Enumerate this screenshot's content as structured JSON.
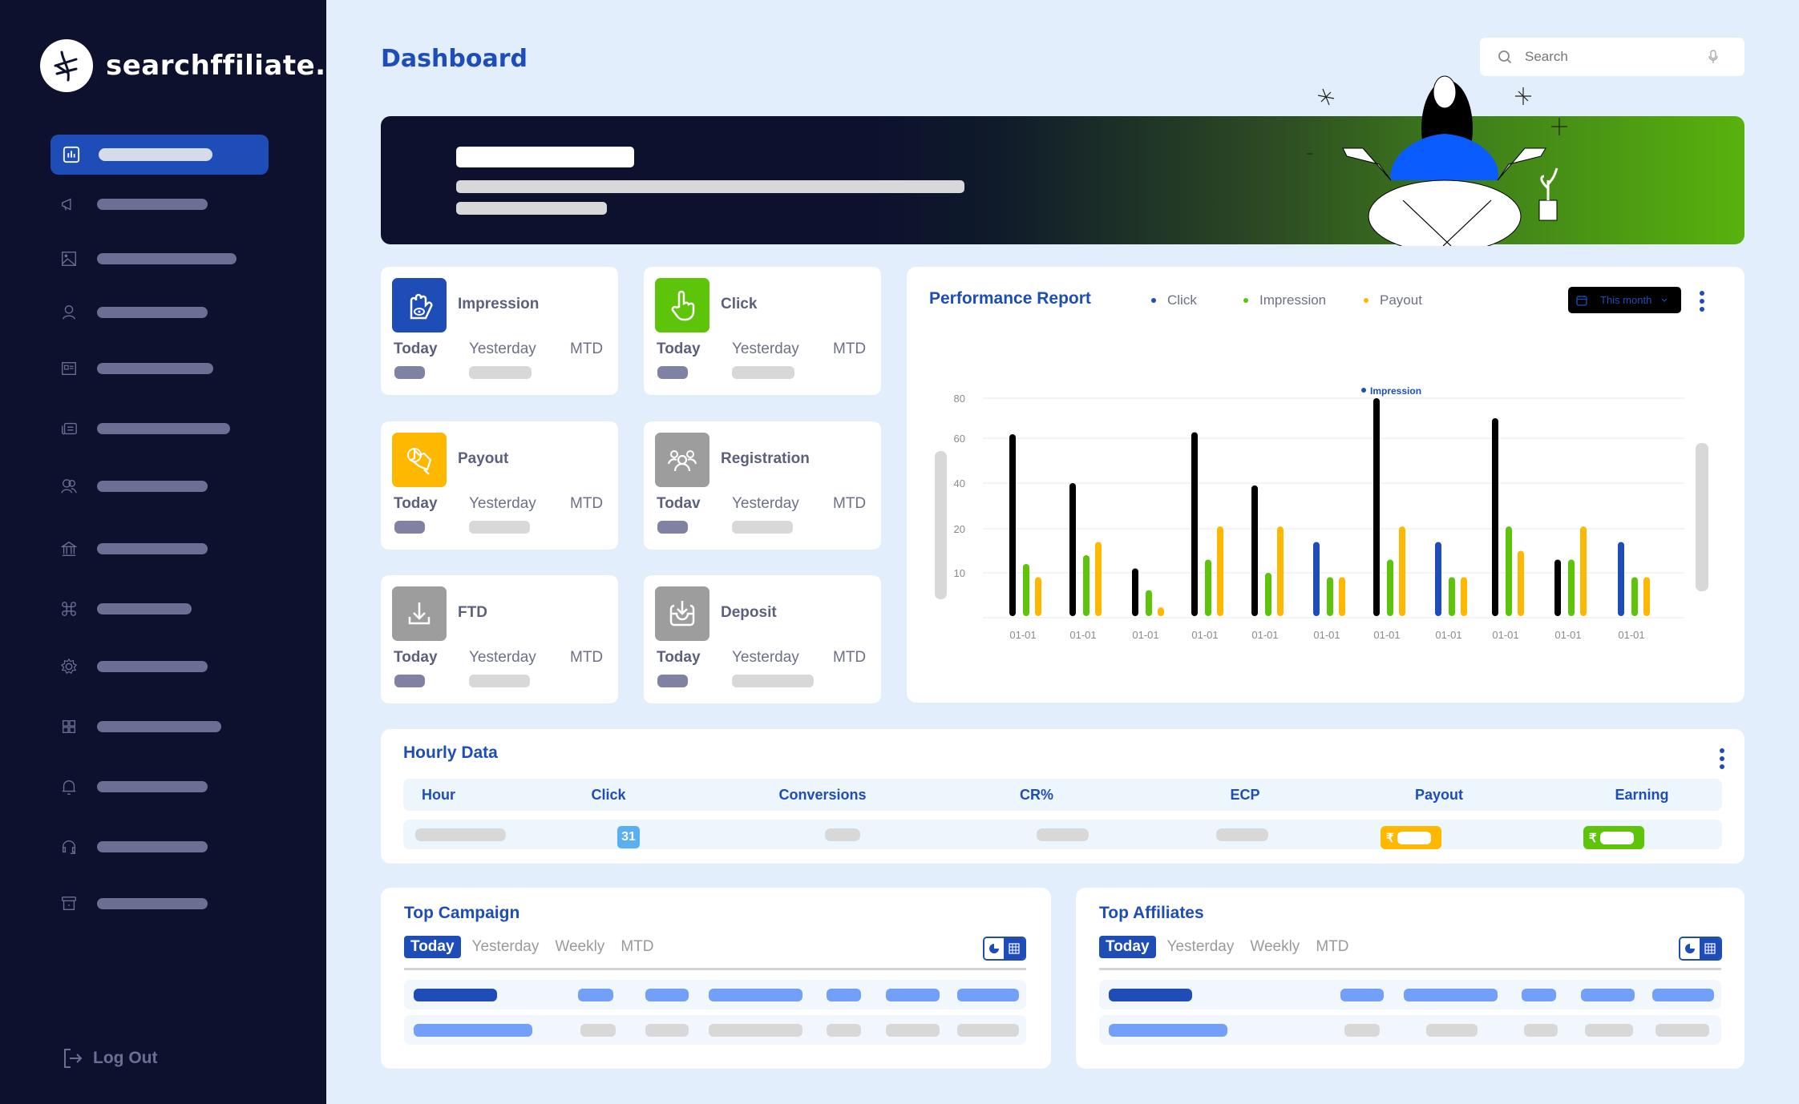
{
  "brand": {
    "name": "searchffiliate."
  },
  "sidebar": {
    "items": [
      {
        "icon": "dashboard-chart-icon",
        "active": true
      },
      {
        "icon": "megaphone-icon",
        "active": false
      },
      {
        "icon": "image-icon",
        "active": false
      },
      {
        "icon": "user-icon",
        "active": false
      },
      {
        "icon": "id-card-icon",
        "active": false
      },
      {
        "icon": "news-icon",
        "active": false
      },
      {
        "icon": "users-icon",
        "active": false
      },
      {
        "icon": "bank-icon",
        "active": false
      },
      {
        "icon": "command-icon",
        "active": false
      },
      {
        "icon": "settings-icon",
        "active": false
      },
      {
        "icon": "grid-icon",
        "active": false
      },
      {
        "icon": "bell-icon",
        "active": false
      },
      {
        "icon": "headset-icon",
        "active": false
      },
      {
        "icon": "archive-icon",
        "active": false
      }
    ],
    "logout_label": "Log Out"
  },
  "header": {
    "title": "Dashboard",
    "search_placeholder": "Search"
  },
  "stats": [
    {
      "title": "Impression",
      "icon": "hand-eye-icon",
      "color": "#1e4db7",
      "today": "Today",
      "yesterday": "Yesterday",
      "mtd": "MTD"
    },
    {
      "title": "Click",
      "icon": "pointer-hand-icon",
      "color": "#5ec40a",
      "today": "Today",
      "yesterday": "Yesterday",
      "mtd": "MTD"
    },
    {
      "title": "Payout",
      "icon": "payout-hand-icon",
      "color": "#ffb800",
      "today": "Today",
      "yesterday": "Yesterday",
      "mtd": "MTD"
    },
    {
      "title": "Registration",
      "icon": "group-icon",
      "color": "#9d9d9d",
      "today": "Todav",
      "yesterday": "Yesterday",
      "mtd": "MTD"
    },
    {
      "title": "FTD",
      "icon": "download-icon",
      "color": "#9d9d9d",
      "today": "Today",
      "yesterday": "Yesterday",
      "mtd": "MTD"
    },
    {
      "title": "Deposit",
      "icon": "inbox-download-icon",
      "color": "#9d9d9d",
      "today": "Today",
      "yesterday": "Yesterday",
      "mtd": "MTD"
    }
  ],
  "performance": {
    "title": "Performance Report",
    "legend": [
      {
        "label": "Click",
        "color": "#1e4db7"
      },
      {
        "label": "Impression",
        "color": "#5ec40a"
      },
      {
        "label": "Payout",
        "color": "#ffb800"
      }
    ],
    "date_range": "This month",
    "tooltip_label": "Impression"
  },
  "chart_data": {
    "type": "bar",
    "title": "Performance Report",
    "xlabel": "",
    "ylabel": "",
    "yticks": [
      10,
      20,
      40,
      60,
      80
    ],
    "ylim": [
      0,
      82
    ],
    "grid": true,
    "legend_position": "top",
    "categories": [
      "01-01",
      "01-01",
      "01-01",
      "01-01",
      "01-01",
      "01-01",
      "01-01",
      "01-01",
      "01-01",
      "01-01",
      "01-01"
    ],
    "series": [
      {
        "name": "Click",
        "colors": [
          "#000000",
          "#000000",
          "#000000",
          "#000000",
          "#000000",
          "#1e4db7",
          "#000000",
          "#1e4db7",
          "#000000",
          "#000000",
          "#1e4db7"
        ],
        "values": [
          62,
          40,
          11,
          63,
          39,
          17,
          80,
          17,
          70,
          13,
          17
        ]
      },
      {
        "name": "Impression",
        "color": "#5ec40a",
        "values": [
          12,
          14,
          6,
          13,
          10,
          9,
          13,
          9,
          21,
          13,
          9
        ]
      },
      {
        "name": "Payout",
        "color": "#ffb800",
        "values": [
          9,
          17,
          2,
          21,
          21,
          9,
          21,
          9,
          15,
          21,
          9
        ]
      }
    ]
  },
  "hourly": {
    "title": "Hourly Data",
    "columns": [
      "Hour",
      "Click",
      "Conversions",
      "CR%",
      "ECP",
      "Payout",
      "Earning"
    ],
    "row": {
      "click": "31",
      "currency": "₹"
    },
    "colors": {
      "payout": "#ffb800",
      "earning": "#5ec40a"
    }
  },
  "top_campaign": {
    "title": "Top Campaign",
    "tabs": [
      "Today",
      "Yesterday",
      "Weekly",
      "MTD"
    ],
    "active_tab": 0
  },
  "top_affiliates": {
    "title": "Top Affiliates",
    "tabs": [
      "Today",
      "Yesterday",
      "Weekly",
      "MTD"
    ],
    "active_tab": 0
  }
}
